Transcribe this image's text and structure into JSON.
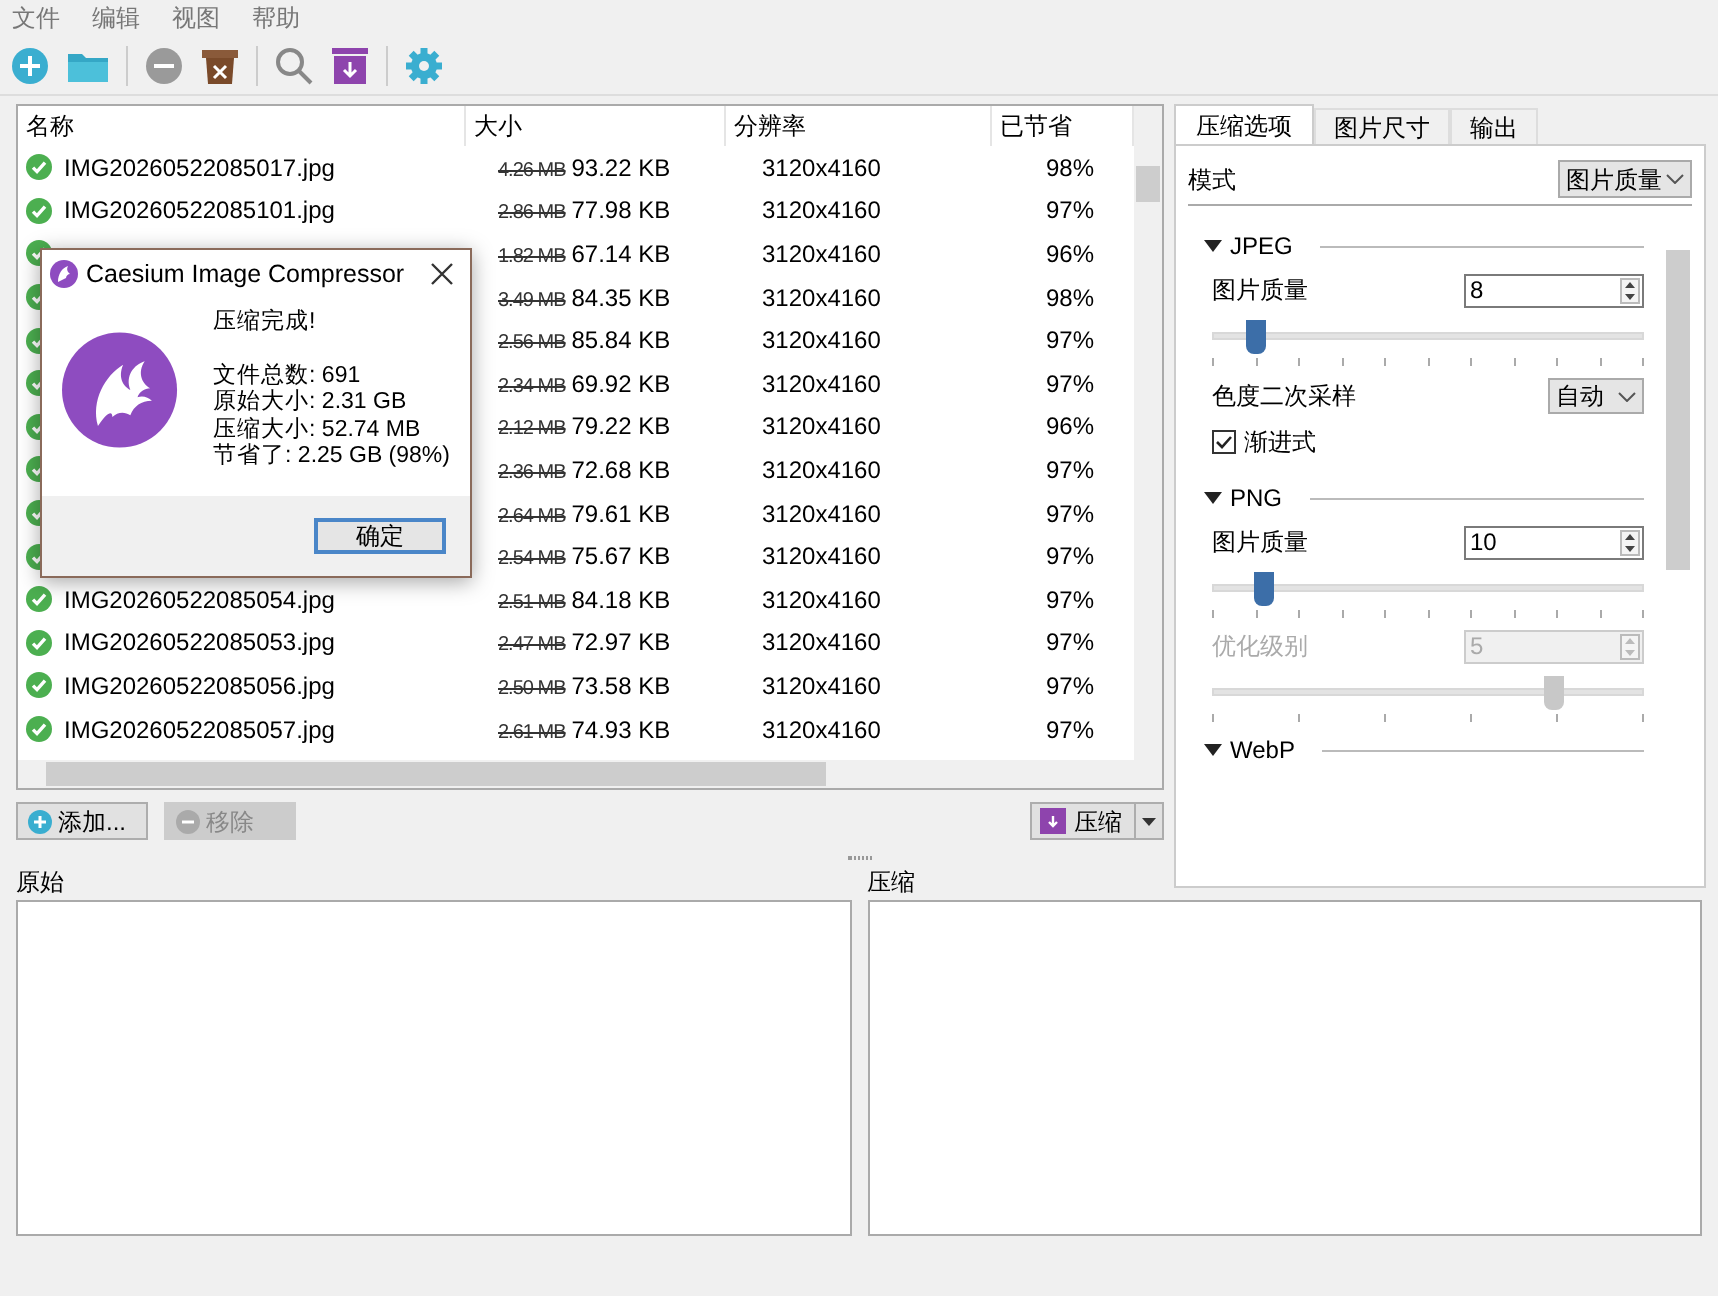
{
  "menu": [
    "文件",
    "编辑",
    "视图",
    "帮助"
  ],
  "list": {
    "columns": [
      "名称",
      "大小",
      "分辨率",
      "已节省"
    ],
    "rows": [
      {
        "name": "IMG20260522085017.jpg",
        "original": "4.26 MB",
        "compressed": "93.22 KB",
        "resolution": "3120x4160",
        "saved": "98%"
      },
      {
        "name": "IMG20260522085101.jpg",
        "original": "2.86 MB",
        "compressed": "77.98 KB",
        "resolution": "3120x4160",
        "saved": "97%"
      },
      {
        "original": "1.82 MB",
        "compressed": "67.14 KB",
        "resolution": "3120x4160",
        "saved": "96%"
      },
      {
        "original": "3.49 MB",
        "compressed": "84.35 KB",
        "resolution": "3120x4160",
        "saved": "98%"
      },
      {
        "original": "2.56 MB",
        "compressed": "85.84 KB",
        "resolution": "3120x4160",
        "saved": "97%"
      },
      {
        "original": "2.34 MB",
        "compressed": "69.92 KB",
        "resolution": "3120x4160",
        "saved": "97%"
      },
      {
        "original": "2.12 MB",
        "compressed": "79.22 KB",
        "resolution": "3120x4160",
        "saved": "96%"
      },
      {
        "original": "2.36 MB",
        "compressed": "72.68 KB",
        "resolution": "3120x4160",
        "saved": "97%"
      },
      {
        "original": "2.64 MB",
        "compressed": "79.61 KB",
        "resolution": "3120x4160",
        "saved": "97%"
      },
      {
        "original": "2.54 MB",
        "compressed": "75.67 KB",
        "resolution": "3120x4160",
        "saved": "97%"
      },
      {
        "name": "IMG20260522085054.jpg",
        "original": "2.51 MB",
        "compressed": "84.18 KB",
        "resolution": "3120x4160",
        "saved": "97%"
      },
      {
        "name": "IMG20260522085053.jpg",
        "original": "2.47 MB",
        "compressed": "72.97 KB",
        "resolution": "3120x4160",
        "saved": "97%"
      },
      {
        "name": "IMG20260522085056.jpg",
        "original": "2.50 MB",
        "compressed": "73.58 KB",
        "resolution": "3120x4160",
        "saved": "97%"
      },
      {
        "name": "IMG20260522085057.jpg",
        "original": "2.61 MB",
        "compressed": "74.93 KB",
        "resolution": "3120x4160",
        "saved": "97%"
      }
    ]
  },
  "dialog": {
    "title": "Caesium Image Compressor",
    "heading": "压缩完成!",
    "lines": [
      "文件总数: 691",
      "原始大小: 2.31 GB",
      "压缩大小: 52.74 MB",
      "节省了: 2.25 GB (98%)"
    ],
    "button": "确定"
  },
  "buttons": [
    {
      "label": "添加...",
      "kind": "add",
      "disabled": false
    },
    {
      "label": "移除",
      "kind": "remove",
      "disabled": true
    }
  ],
  "compress_button": "压缩",
  "tabs": [
    {
      "label": "压缩选项",
      "selected": true
    },
    {
      "label": "图片尺寸",
      "selected": false
    },
    {
      "label": "输出",
      "selected": false
    }
  ],
  "mode": {
    "label": "模式",
    "value": "图片质量"
  },
  "sections": [
    {
      "title": "JPEG",
      "items": [
        {
          "kind": "spin",
          "label": "图片质量",
          "value": "8",
          "disabled": false
        },
        {
          "kind": "slider",
          "level": 0.1
        },
        {
          "kind": "select",
          "label": "色度二次采样",
          "value": "自动"
        },
        {
          "kind": "checkbox",
          "label": "渐进式",
          "checked": true
        }
      ]
    },
    {
      "title": "PNG",
      "items": [
        {
          "kind": "spin",
          "label": "图片质量",
          "value": "10",
          "disabled": false
        },
        {
          "kind": "slider",
          "level": 0.12
        },
        {
          "kind": "spin",
          "label": "优化级别",
          "value": "5",
          "disabled": true
        },
        {
          "kind": "slider",
          "level": 0.79,
          "disabled": true
        }
      ]
    },
    {
      "title": "WebP"
    }
  ],
  "panes": [
    "原始",
    "压缩"
  ]
}
